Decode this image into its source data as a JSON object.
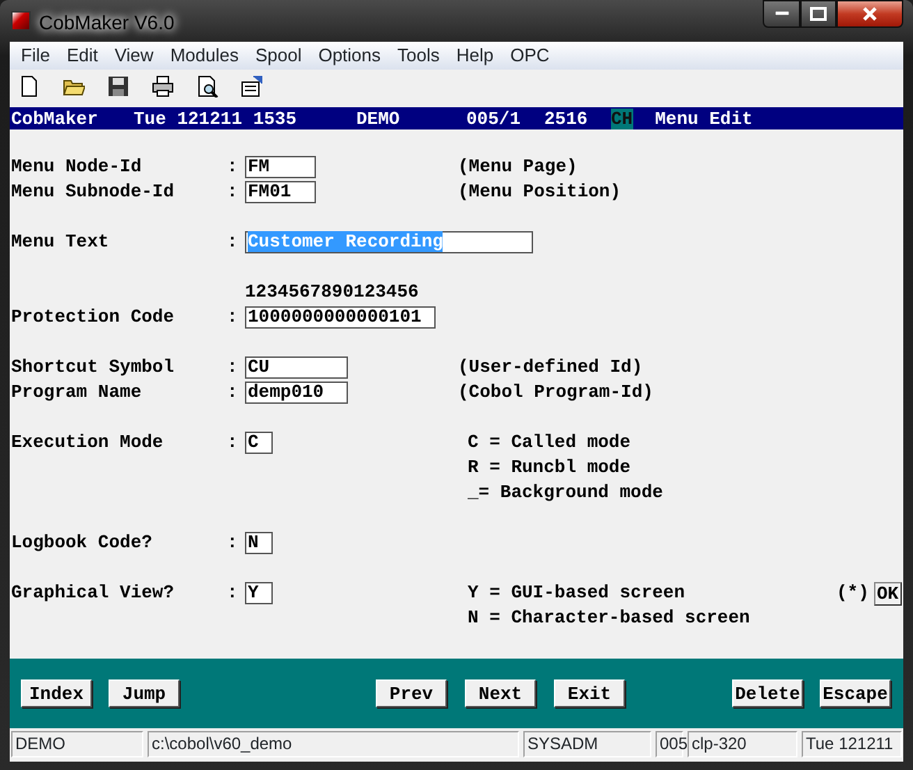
{
  "window": {
    "title": "CobMaker V6.0"
  },
  "menu": [
    "File",
    "Edit",
    "View",
    "Modules",
    "Spool",
    "Options",
    "Tools",
    "Help",
    "OPC"
  ],
  "toolbar": [
    {
      "kind": "new"
    },
    {
      "kind": "open"
    },
    {
      "kind": "save"
    },
    {
      "kind": "print"
    },
    {
      "kind": "preview"
    },
    {
      "kind": "properties"
    }
  ],
  "header": {
    "app": "CobMaker",
    "date": "Tue 121211 1535",
    "user": "DEMO",
    "terminal": "005/1",
    "number": "2516",
    "language": "CH",
    "mode": "Menu Edit"
  },
  "form": [
    [
      {
        "kind": "field",
        "label": "Menu Node-Id",
        "separator": ":",
        "value": "FM",
        "selected": false,
        "notes": [
          "(Menu Page)"
        ]
      },
      {
        "kind": "field",
        "label": "Menu Subnode-Id",
        "separator": ":",
        "value": "FM01",
        "selected": false,
        "notes": [
          "(Menu Position)"
        ]
      }
    ],
    [
      {
        "kind": "field",
        "label": "Menu Text",
        "separator": ":",
        "value": "Customer Recording",
        "selected": true
      }
    ],
    [
      {
        "kind": "ruler",
        "text": "1234567890123456"
      },
      {
        "kind": "field",
        "label": "Protection Code",
        "separator": ":",
        "value": "1000000000000101",
        "selected": false
      }
    ],
    [
      {
        "kind": "field",
        "label": "Shortcut Symbol",
        "separator": ":",
        "value": "CU",
        "selected": false,
        "notes": [
          "(User-defined Id)"
        ]
      },
      {
        "kind": "field",
        "label": "Program Name",
        "separator": ":",
        "value": "demp010",
        "selected": false,
        "notes": [
          "(Cobol Program-Id)"
        ]
      }
    ],
    [
      {
        "kind": "choice",
        "label": "Execution Mode",
        "separator": ":",
        "value": "C",
        "selected": false,
        "notes": [
          "C = Called mode",
          "R = Runcbl mode",
          "_= Background mode"
        ]
      }
    ],
    [
      {
        "kind": "choice",
        "label": "Logbook Code?",
        "separator": ":",
        "value": "N",
        "selected": false
      }
    ],
    [
      {
        "kind": "choice",
        "label": "Graphical View?",
        "separator": ":",
        "value": "Y",
        "selected": false,
        "notes": [
          "Y = GUI-based screen",
          "N = Character-based screen"
        ],
        "extra": {
          "mark": "(*)",
          "button": "OK"
        }
      }
    ]
  ],
  "buttons": {
    "left": [
      "Index",
      "Jump"
    ],
    "center": [
      "Prev",
      "Next",
      "Exit"
    ],
    "right": [
      "Delete",
      "Escape"
    ]
  },
  "status_bar": [
    "DEMO",
    "c:\\cobol\\v60_demo",
    "SYSADM",
    "005",
    "clp-320",
    "Tue 121211"
  ]
}
